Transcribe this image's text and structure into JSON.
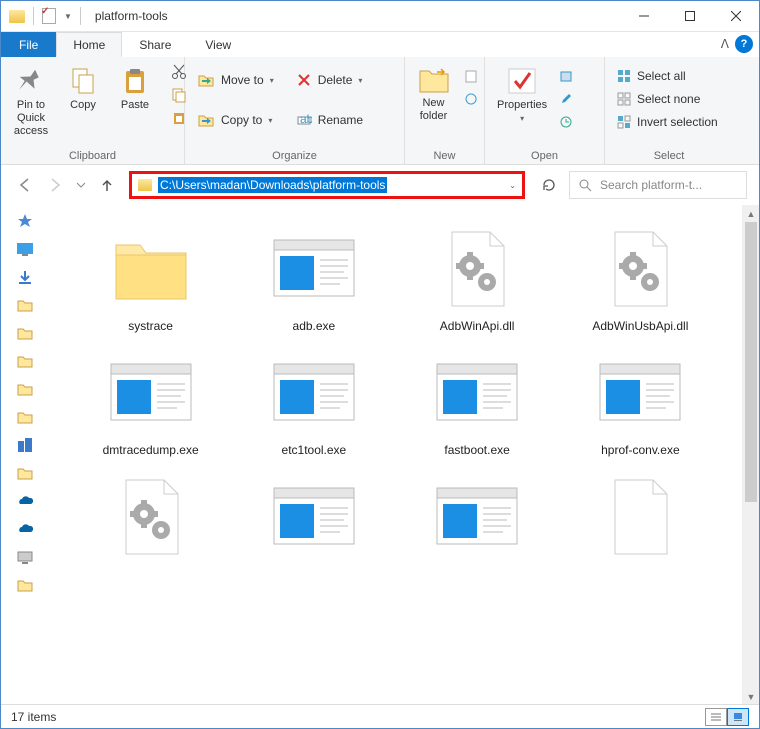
{
  "window": {
    "title": "platform-tools"
  },
  "menubar": {
    "file": "File",
    "tabs": [
      "Home",
      "Share",
      "View"
    ],
    "active_index": 0
  },
  "ribbon": {
    "clipboard": {
      "label": "Clipboard",
      "pin": "Pin to Quick access",
      "copy": "Copy",
      "paste": "Paste"
    },
    "organize": {
      "label": "Organize",
      "move": "Move to",
      "copy": "Copy to",
      "delete": "Delete",
      "rename": "Rename"
    },
    "new": {
      "label": "New",
      "newfolder": "New folder"
    },
    "open": {
      "label": "Open",
      "properties": "Properties"
    },
    "select": {
      "label": "Select",
      "all": "Select all",
      "none": "Select none",
      "invert": "Invert selection"
    }
  },
  "address": {
    "path": "C:\\Users\\madan\\Downloads\\platform-tools"
  },
  "search": {
    "placeholder": "Search platform-t..."
  },
  "items": [
    {
      "name": "systrace",
      "type": "folder"
    },
    {
      "name": "adb.exe",
      "type": "exe"
    },
    {
      "name": "AdbWinApi.dll",
      "type": "dll"
    },
    {
      "name": "AdbWinUsbApi.dll",
      "type": "dll"
    },
    {
      "name": "dmtracedump.exe",
      "type": "exe"
    },
    {
      "name": "etc1tool.exe",
      "type": "exe"
    },
    {
      "name": "fastboot.exe",
      "type": "exe"
    },
    {
      "name": "hprof-conv.exe",
      "type": "exe"
    },
    {
      "name": "",
      "type": "dll"
    },
    {
      "name": "",
      "type": "exe"
    },
    {
      "name": "",
      "type": "exe"
    },
    {
      "name": "",
      "type": "blank"
    }
  ],
  "status": {
    "count": "17 items"
  }
}
